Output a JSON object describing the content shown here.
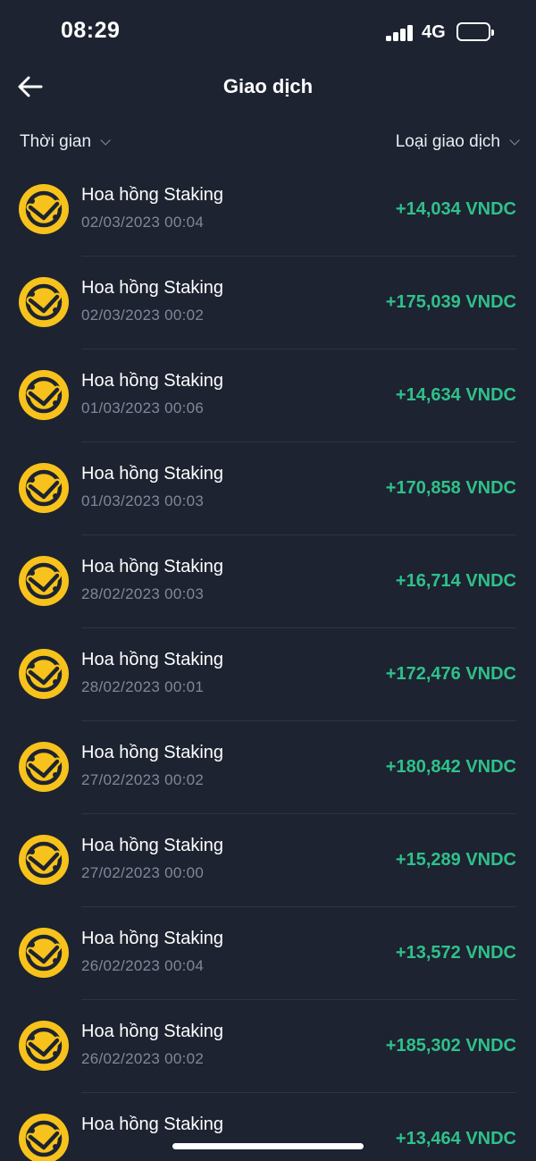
{
  "status": {
    "time": "08:29",
    "network": "4G"
  },
  "header": {
    "title": "Giao dịch"
  },
  "filters": {
    "time_label": "Thời gian",
    "type_label": "Loại giao dịch"
  },
  "colors": {
    "background": "#1d2330",
    "accent_positive": "#2fc18b",
    "coin": "#f7c21b"
  },
  "transactions": [
    {
      "icon": "vndc-coin-icon",
      "title": "Hoa hồng Staking",
      "time": "02/03/2023 00:04",
      "amount": "+14,034 VNDC"
    },
    {
      "icon": "vndc-coin-icon",
      "title": "Hoa hồng Staking",
      "time": "02/03/2023 00:02",
      "amount": "+175,039 VNDC"
    },
    {
      "icon": "vndc-coin-icon",
      "title": "Hoa hồng Staking",
      "time": "01/03/2023 00:06",
      "amount": "+14,634 VNDC"
    },
    {
      "icon": "vndc-coin-icon",
      "title": "Hoa hồng Staking",
      "time": "01/03/2023 00:03",
      "amount": "+170,858 VNDC"
    },
    {
      "icon": "vndc-coin-icon",
      "title": "Hoa hồng Staking",
      "time": "28/02/2023 00:03",
      "amount": "+16,714 VNDC"
    },
    {
      "icon": "vndc-coin-icon",
      "title": "Hoa hồng Staking",
      "time": "28/02/2023 00:01",
      "amount": "+172,476 VNDC"
    },
    {
      "icon": "vndc-coin-icon",
      "title": "Hoa hồng Staking",
      "time": "27/02/2023 00:02",
      "amount": "+180,842 VNDC"
    },
    {
      "icon": "vndc-coin-icon",
      "title": "Hoa hồng Staking",
      "time": "27/02/2023 00:00",
      "amount": "+15,289 VNDC"
    },
    {
      "icon": "vndc-coin-icon",
      "title": "Hoa hồng Staking",
      "time": "26/02/2023 00:04",
      "amount": "+13,572 VNDC"
    },
    {
      "icon": "vndc-coin-icon",
      "title": "Hoa hồng Staking",
      "time": "26/02/2023 00:02",
      "amount": "+185,302 VNDC"
    },
    {
      "icon": "vndc-coin-icon",
      "title": "Hoa hồng Staking",
      "time": "",
      "amount": "+13,464 VNDC"
    }
  ]
}
